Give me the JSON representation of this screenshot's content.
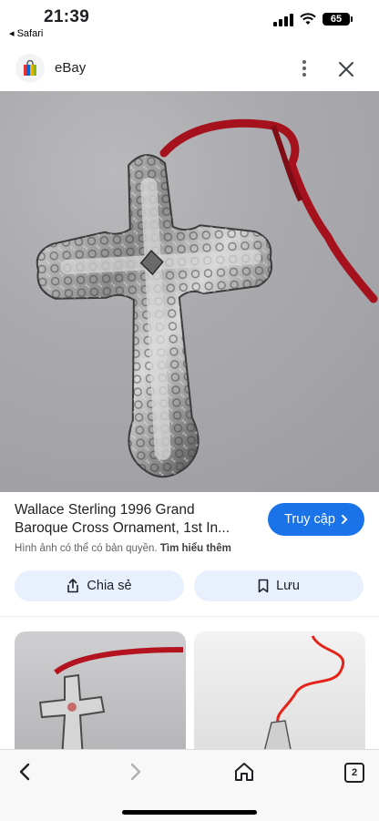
{
  "status_bar": {
    "time": "21:39",
    "back_app": "◂ Safari",
    "battery": "65"
  },
  "header": {
    "site_name": "eBay",
    "logo_icon": "ebay-bag-icon",
    "menu_icon": "more-vert-icon",
    "close_icon": "close-icon"
  },
  "result": {
    "title_line1": "Wallace Sterling 1996 Grand",
    "title_line2": "Baroque Cross Ornament, 1st In...",
    "visit_label": "Truy cập",
    "copyright_text": "Hình ảnh có thể có bản quyền.",
    "learn_more": "Tìm hiểu thêm",
    "share_label": "Chia sẻ",
    "save_label": "Lưu"
  },
  "bottom_nav": {
    "tab_count": "2"
  },
  "colors": {
    "accent": "#1a73e8",
    "chip_bg": "#e8f0fe",
    "ribbon": "#b3121f"
  }
}
